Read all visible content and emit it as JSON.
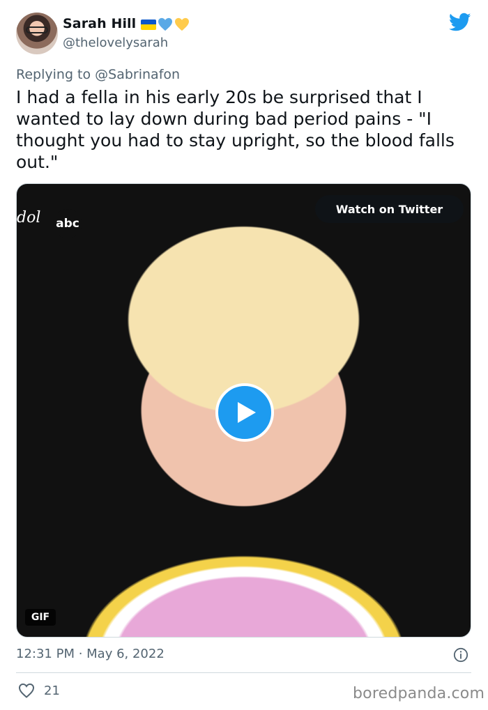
{
  "author": {
    "name": "Sarah Hill",
    "handle": "@thelovelysarah"
  },
  "reply": {
    "prefix": "Replying to ",
    "mention": "@Sabrinafon"
  },
  "tweet": {
    "text": "I had a fella in his early 20s be surprised that I\nwanted to lay down during bad period pains - \"I\nthought you had to stay upright, so the blood falls\nout.\""
  },
  "media": {
    "watch_label": "Watch on Twitter",
    "channel_logo": "abc",
    "show_logo": "dol",
    "gif_label": "GIF"
  },
  "meta": {
    "timestamp": "12:31 PM · May 6, 2022",
    "like_count": "21"
  },
  "watermark": "boredpanda.com",
  "colors": {
    "twitter_blue": "#1d9bf0",
    "secondary_text": "#536471",
    "primary_text": "#0f1419"
  },
  "icons": {
    "bird": "twitter-bird-icon",
    "heart": "heart-icon",
    "info": "info-icon",
    "play": "play-icon"
  }
}
